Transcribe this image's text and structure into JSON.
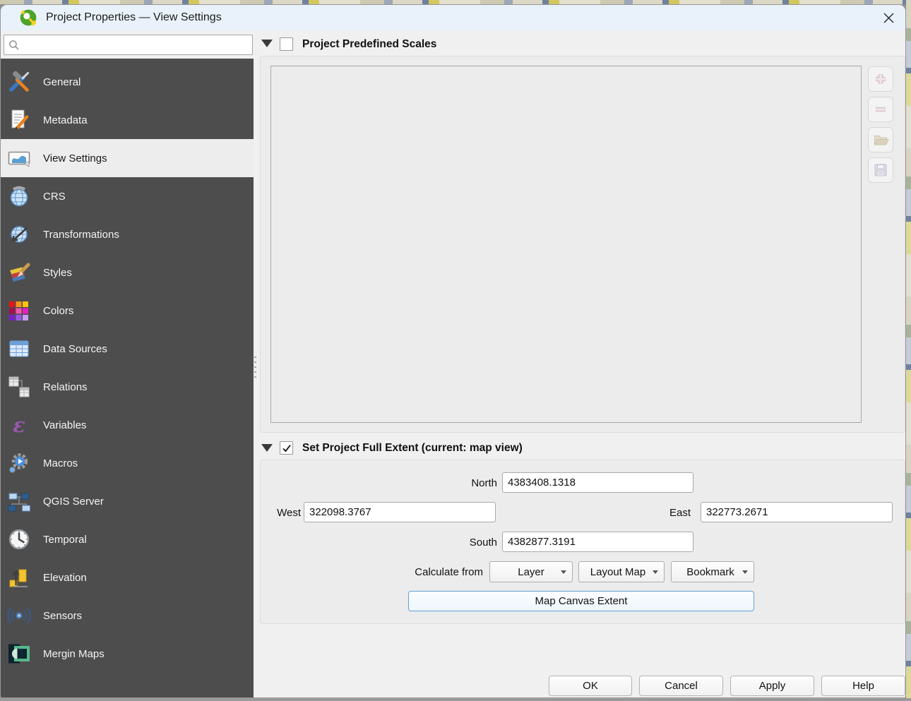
{
  "colors": {
    "titlebar_bg": "#e9f2fa",
    "sidebar_bg": "#4d4d4d",
    "sidebar_selected_bg": "#ededed",
    "dialog_bg": "#f0f0f0",
    "accent_blue": "#61a2d8"
  },
  "window": {
    "title": "Project Properties — View Settings"
  },
  "sidebar": {
    "search": {
      "placeholder": ""
    },
    "variables_icon_glyph": "ε",
    "items": [
      {
        "label": "General",
        "selected": false
      },
      {
        "label": "Metadata",
        "selected": false
      },
      {
        "label": "View Settings",
        "selected": true
      },
      {
        "label": "CRS",
        "selected": false
      },
      {
        "label": "Transformations",
        "selected": false
      },
      {
        "label": "Styles",
        "selected": false
      },
      {
        "label": "Colors",
        "selected": false
      },
      {
        "label": "Data Sources",
        "selected": false
      },
      {
        "label": "Relations",
        "selected": false
      },
      {
        "label": "Variables",
        "selected": false
      },
      {
        "label": "Macros",
        "selected": false
      },
      {
        "label": "QGIS Server",
        "selected": false
      },
      {
        "label": "Temporal",
        "selected": false
      },
      {
        "label": "Elevation",
        "selected": false
      },
      {
        "label": "Sensors",
        "selected": false
      },
      {
        "label": "Mergin Maps",
        "selected": false
      }
    ]
  },
  "scales_section": {
    "title": "Project Predefined Scales",
    "checked": false,
    "toolbar": [
      {
        "icon": "plus-icon"
      },
      {
        "icon": "minus-icon"
      },
      {
        "icon": "folder-open-icon"
      },
      {
        "icon": "save-icon"
      }
    ]
  },
  "extent_section": {
    "title": "Set Project Full Extent (current: map view)",
    "checked": true,
    "fields": {
      "north": {
        "label": "North",
        "value": "4383408.1318"
      },
      "west": {
        "label": "West",
        "value": "322098.3767"
      },
      "east": {
        "label": "East",
        "value": "322773.2671"
      },
      "south": {
        "label": "South",
        "value": "4382877.3191"
      }
    },
    "calculate_from_label": "Calculate from",
    "dropdowns": [
      {
        "label": "Layer"
      },
      {
        "label": "Layout Map"
      },
      {
        "label": "Bookmark"
      }
    ],
    "map_canvas_button": "Map Canvas Extent"
  },
  "footer": {
    "buttons": [
      {
        "label": "OK"
      },
      {
        "label": "Cancel"
      },
      {
        "label": "Apply"
      },
      {
        "label": "Help"
      }
    ]
  }
}
